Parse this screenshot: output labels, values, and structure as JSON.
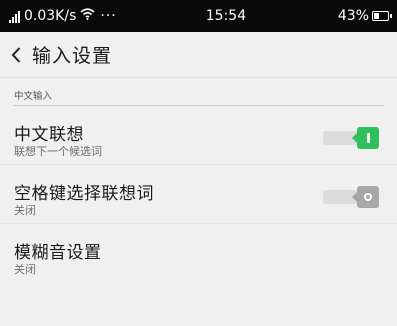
{
  "status_bar": {
    "network_rate": "0.03K/s",
    "more": "···",
    "time": "15:54",
    "battery": "43%",
    "battery_level": 0.43
  },
  "header": {
    "title": "输入设置"
  },
  "section": {
    "label": "中文输入"
  },
  "settings": [
    {
      "title": "中文联想",
      "subtitle": "联想下一个候选词",
      "toggle": "on"
    },
    {
      "title": "空格键选择联想词",
      "subtitle": "关闭",
      "toggle": "off"
    },
    {
      "title": "模糊音设置",
      "subtitle": "关闭"
    }
  ],
  "colors": {
    "toggle_on": "#2fbf5b",
    "toggle_off": "#a7a7a7",
    "background": "#f0f0f0"
  }
}
